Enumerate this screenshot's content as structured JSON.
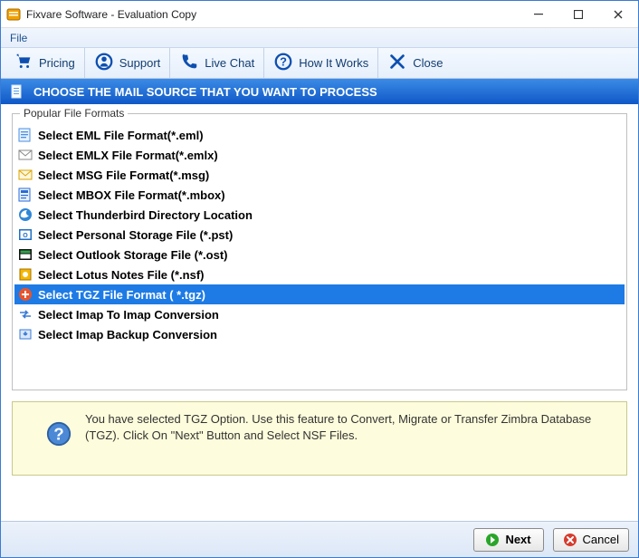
{
  "window": {
    "title": "Fixvare Software - Evaluation Copy"
  },
  "menu": {
    "file": "File"
  },
  "toolbar": {
    "pricing": "Pricing",
    "support": "Support",
    "livechat": "Live Chat",
    "howitworks": "How It Works",
    "close": "Close"
  },
  "instruction": "CHOOSE THE MAIL SOURCE THAT YOU WANT TO PROCESS",
  "group": {
    "title": "Popular File Formats",
    "items": [
      {
        "label": "Select EML File Format(*.eml)"
      },
      {
        "label": "Select EMLX File Format(*.emlx)"
      },
      {
        "label": "Select MSG File Format(*.msg)"
      },
      {
        "label": "Select MBOX File Format(*.mbox)"
      },
      {
        "label": "Select Thunderbird Directory Location"
      },
      {
        "label": "Select Personal Storage File (*.pst)"
      },
      {
        "label": "Select Outlook Storage File (*.ost)"
      },
      {
        "label": "Select Lotus Notes File (*.nsf)"
      },
      {
        "label": "Select TGZ File Format ( *.tgz)"
      },
      {
        "label": "Select Imap To Imap Conversion"
      },
      {
        "label": "Select Imap Backup Conversion"
      }
    ],
    "selected_index": 8
  },
  "tip": "You have selected TGZ Option. Use this feature to Convert, Migrate or Transfer Zimbra Database (TGZ). Click On \"Next\" Button and Select NSF Files.",
  "footer": {
    "next": "Next",
    "cancel": "Cancel"
  },
  "colors": {
    "accent": "#1e7be5",
    "header_gradient_from": "#3b8be6",
    "header_gradient_to": "#0f58c7",
    "tip_bg": "#fdfcdc"
  }
}
